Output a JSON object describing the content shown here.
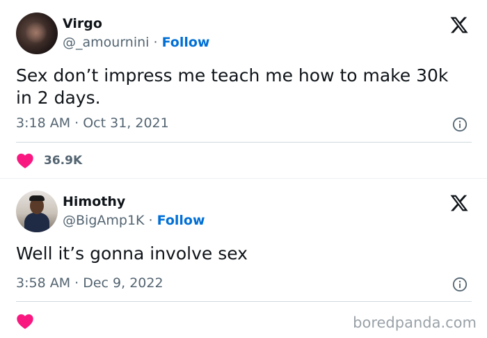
{
  "tweets": [
    {
      "name": "Virgo",
      "handle": "@_amournini",
      "separator": "·",
      "follow_label": "Follow",
      "text": "Sex don’t impress me teach me how to make 30k in 2 days.",
      "timestamp": "3:18 AM · Oct 31, 2021",
      "likes": "36.9K",
      "avatar_icon": "avatar-photo",
      "brand_icon": "x-logo-icon",
      "info_icon": "info-icon",
      "like_icon": "heart-icon"
    },
    {
      "name": "Himothy",
      "handle": "@BigAmp1K",
      "separator": "·",
      "follow_label": "Follow",
      "text": "Well it’s gonna involve sex",
      "timestamp": "3:58 AM · Dec 9, 2022",
      "likes": "",
      "avatar_icon": "avatar-photo",
      "brand_icon": "x-logo-icon",
      "info_icon": "info-icon",
      "like_icon": "heart-icon"
    }
  ],
  "watermark": "boredpanda.com",
  "colors": {
    "heart": "#f91880",
    "follow": "#006fd6",
    "secondary_text": "#536471",
    "primary_text": "#0f1419"
  }
}
